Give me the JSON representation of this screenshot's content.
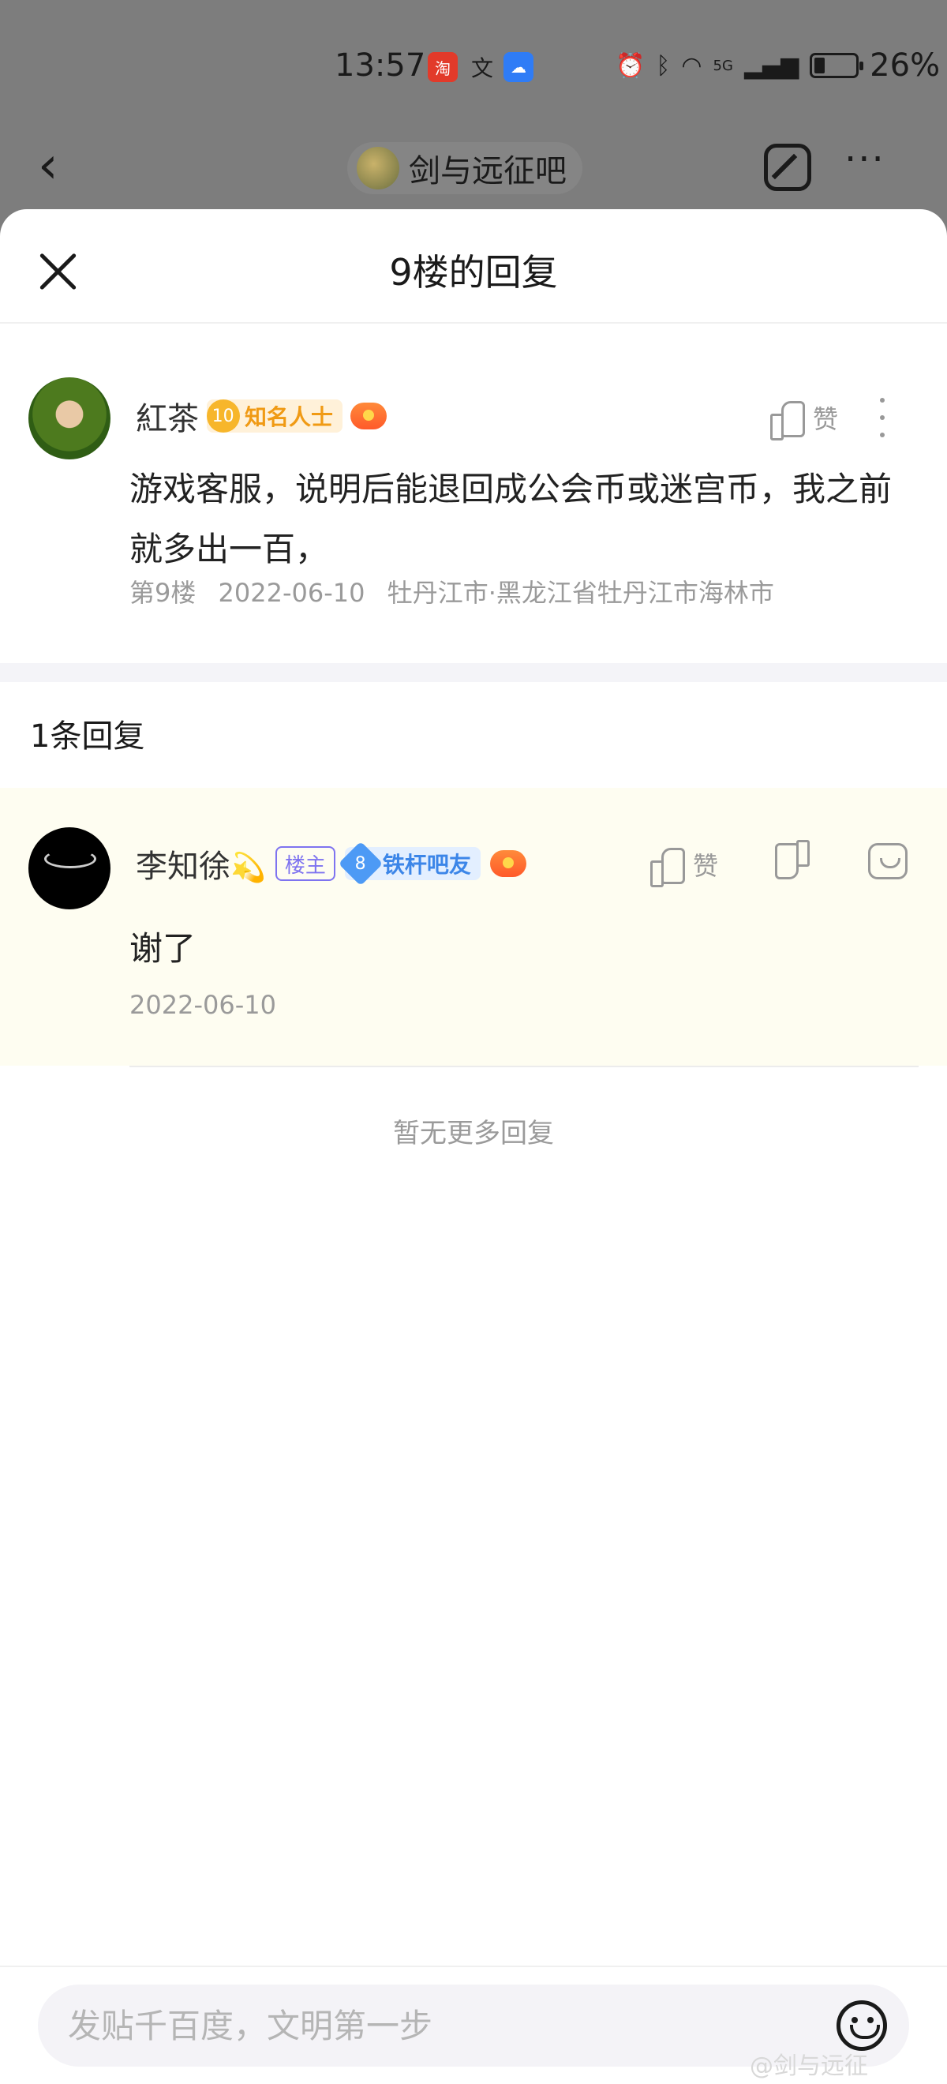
{
  "status_bar": {
    "time": "13:57",
    "apps": [
      "taobao-icon",
      "translate-icon",
      "cloud-icon"
    ],
    "taobao_glyph": "淘",
    "translate_glyph": "文",
    "cloud_glyph": "☁",
    "network": "5G",
    "battery_percent": "26%",
    "battery_level": 0.26
  },
  "forum_header": {
    "back_glyph": "‹",
    "forum_name": "剑与远征吧",
    "more_glyph": "···"
  },
  "sheet": {
    "title": "9楼的回复"
  },
  "main_post": {
    "author": "紅茶",
    "level": "10",
    "level_title": "知名人士",
    "like_label": "赞",
    "content": "游戏客服，说明后能退回成公会币或迷宫币，我之前就多出一百，",
    "floor": "第9楼",
    "date": "2022-06-10",
    "location": "牡丹江市·黑龙江省牡丹江市海林市"
  },
  "reply_count_label": "1条回复",
  "reply": {
    "author": "李知徐",
    "sparkle": "💫",
    "owner_badge": "楼主",
    "level": "8",
    "level_title": "铁杆吧友",
    "like_label": "赞",
    "content": "谢了",
    "date": "2022-06-10"
  },
  "no_more_label": "暂无更多回复",
  "input": {
    "placeholder": "发贴千百度，文明第一步"
  },
  "watermark": "@剑与远征"
}
